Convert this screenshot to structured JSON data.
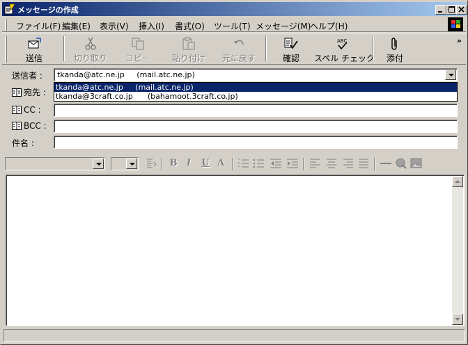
{
  "window": {
    "title": "メッセージの作成"
  },
  "menu": [
    "ファイル(F)",
    "編集(E)",
    "表示(V)",
    "挿入(I)",
    "書式(O)",
    "ツール(T)",
    "メッセージ(M)",
    "ヘルプ(H)"
  ],
  "toolbar": {
    "send": "送信",
    "cut": "切り取り",
    "copy": "コピー",
    "paste": "貼り付け",
    "undo": "元に戻す",
    "check": "確認",
    "spell": "スペル チェック",
    "spell_icon_text": "ABC",
    "attach": "添付",
    "more": "»"
  },
  "headers": {
    "from_label": "送信者 :",
    "to_label": "宛先 :",
    "cc_label": "CC :",
    "bcc_label": "BCC :",
    "subject_label": "件名 :",
    "from_value": "tkanda@atc.ne.jp     (mail.atc.ne.jp)",
    "to_value": "",
    "cc_value": "",
    "bcc_value": "",
    "subject_value": ""
  },
  "from_options": [
    "tkanda@atc.ne.jp     (mail.atc.ne.jp)",
    "tkanda@3craft.co.jp      (bahamoot.3craft.co.jp)"
  ],
  "format": {
    "bold": "B",
    "italic": "I",
    "underline": "U",
    "fontcolor": "A"
  },
  "colors": {
    "titlebar_start": "#0a246a",
    "titlebar_end": "#a6caf0",
    "selection": "#0a246a",
    "face": "#d4d0c8"
  }
}
